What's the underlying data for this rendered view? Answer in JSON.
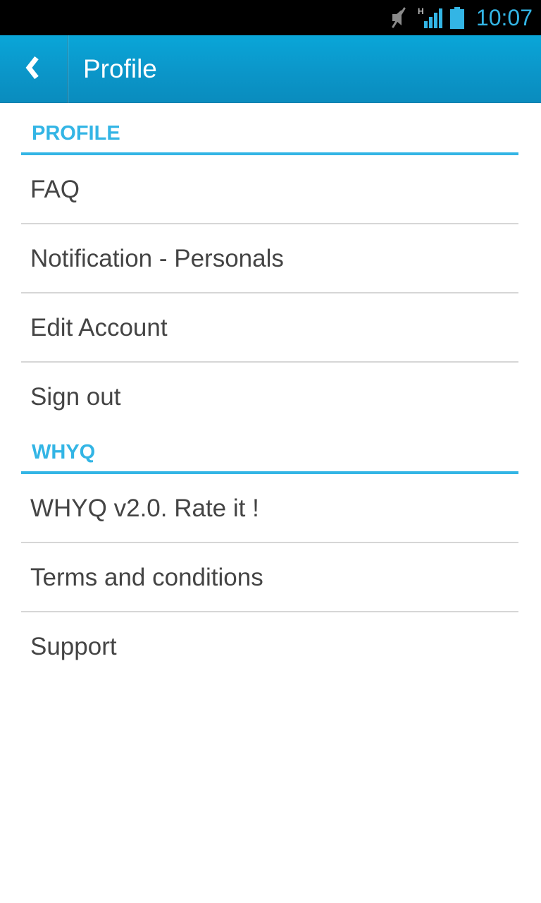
{
  "status_bar": {
    "time": "10:07",
    "network_label": "H",
    "accent_color": "#33b5e5",
    "icons": [
      "mute-icon",
      "signal-icon",
      "battery-icon"
    ]
  },
  "action_bar": {
    "title": "Profile",
    "back_glyph": "❮",
    "background_color": "#0a9ccf"
  },
  "sections": [
    {
      "header": "PROFILE",
      "items": [
        "FAQ",
        "Notification - Personals",
        "Edit Account",
        "Sign out"
      ]
    },
    {
      "header": "WHYQ",
      "items": [
        "WHYQ v2.0. Rate it !",
        "Terms and conditions",
        "Support"
      ]
    }
  ]
}
